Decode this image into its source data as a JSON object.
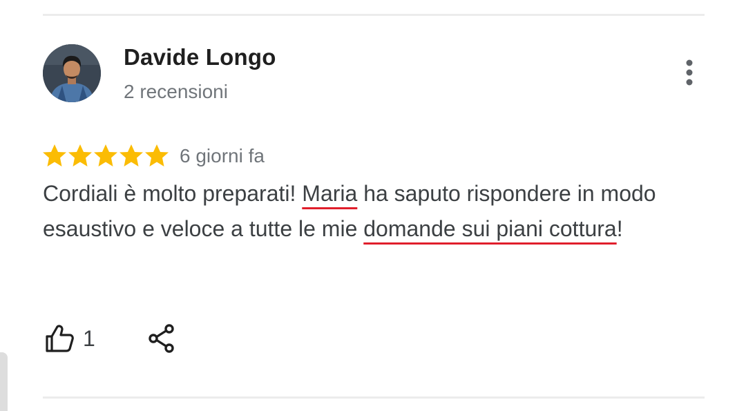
{
  "review": {
    "author_name": "Davide Longo",
    "review_count": "2 recensioni",
    "rating": 5,
    "rating_max": 5,
    "date": "6 giorni fa",
    "text": {
      "part1": "Cordiali è molto preparati! ",
      "highlight1": "Maria",
      "part2": " ha saputo rispondere in modo esaustivo e veloce a tutte le mie ",
      "highlight2": "domande sui piani cottura",
      "part3": "!"
    },
    "likes": "1"
  },
  "icons": {
    "avatar": "profile-photo",
    "more": "more-vert-icon",
    "star": "star-icon",
    "like": "thumb-up-icon",
    "share": "share-icon"
  },
  "colors": {
    "star": "#fbbc04",
    "underline": "#e01e2b",
    "name": "#1f1f1f",
    "secondary": "#70757a",
    "body": "#3c4043"
  }
}
